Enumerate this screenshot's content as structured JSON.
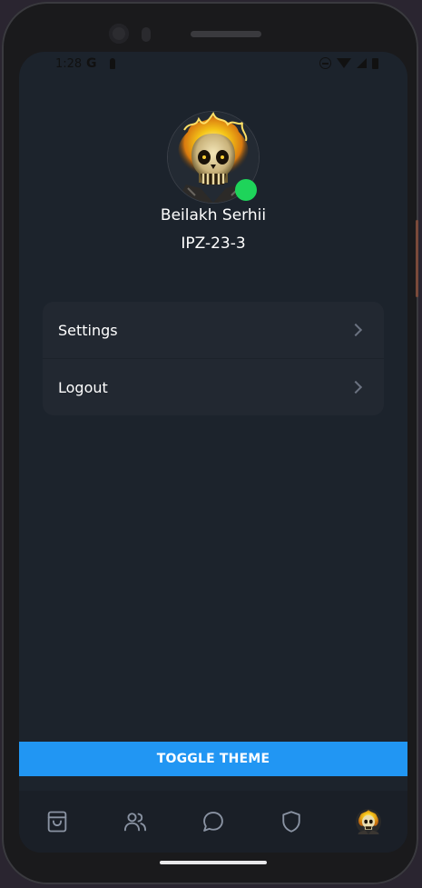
{
  "status_bar": {
    "time": "1:28",
    "g_label": "G"
  },
  "profile": {
    "name": "Beilakh Serhii",
    "group": "IPZ-23-3",
    "online": true,
    "online_color": "#1ed45a",
    "avatar_icon": "flaming-skull-avatar"
  },
  "menu": {
    "items": [
      {
        "label": "Settings",
        "icon": "chevron-right-icon"
      },
      {
        "label": "Logout",
        "icon": "chevron-right-icon"
      }
    ]
  },
  "toggle_theme": {
    "label": "TOGGLE THEME",
    "color": "#2196f3"
  },
  "bottom_nav": {
    "items": [
      {
        "icon": "shopping-bag-icon"
      },
      {
        "icon": "users-icon"
      },
      {
        "icon": "chat-bubble-icon"
      },
      {
        "icon": "shield-icon"
      },
      {
        "icon": "profile-avatar-icon",
        "active": true
      }
    ]
  },
  "colors": {
    "background": "#1c232c",
    "card": "#222831",
    "accent": "#2196f3"
  }
}
